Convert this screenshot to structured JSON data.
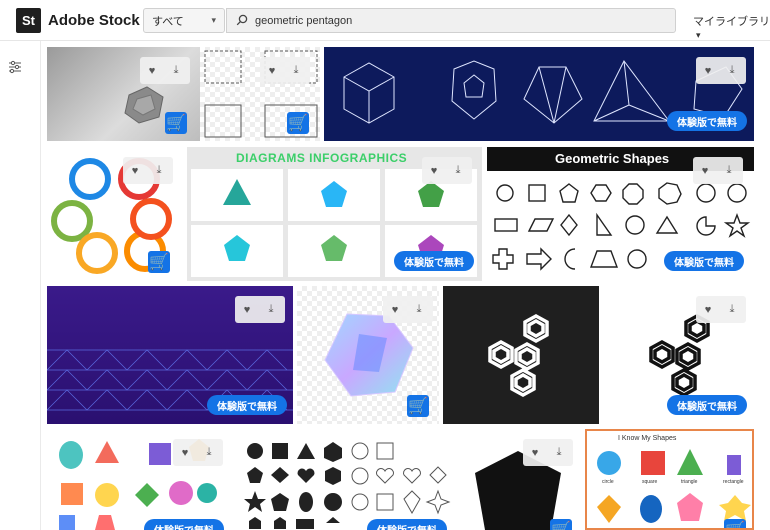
{
  "app": {
    "logo_mark": "St",
    "name": "Adobe Stock"
  },
  "search": {
    "category": "すべて",
    "query": "geometric pentagon"
  },
  "header": {
    "my_library": "マイライブラリ"
  },
  "labels": {
    "trial": "体験版で無料"
  },
  "tiles": {
    "diagrams_title": "DIAGRAMS INFOGRAPHICS",
    "shapes_title": "Geometric Shapes",
    "know_shapes_title": "I Know My Shapes",
    "know_shapes_labels": [
      "circle",
      "square",
      "triangle",
      "rectangle"
    ]
  },
  "colors": {
    "accent": "#1473e6",
    "navy": "#0d1a5c",
    "purple": "#3a1a8a",
    "black": "#1f1f1f",
    "orange_border": "#e8864a"
  }
}
